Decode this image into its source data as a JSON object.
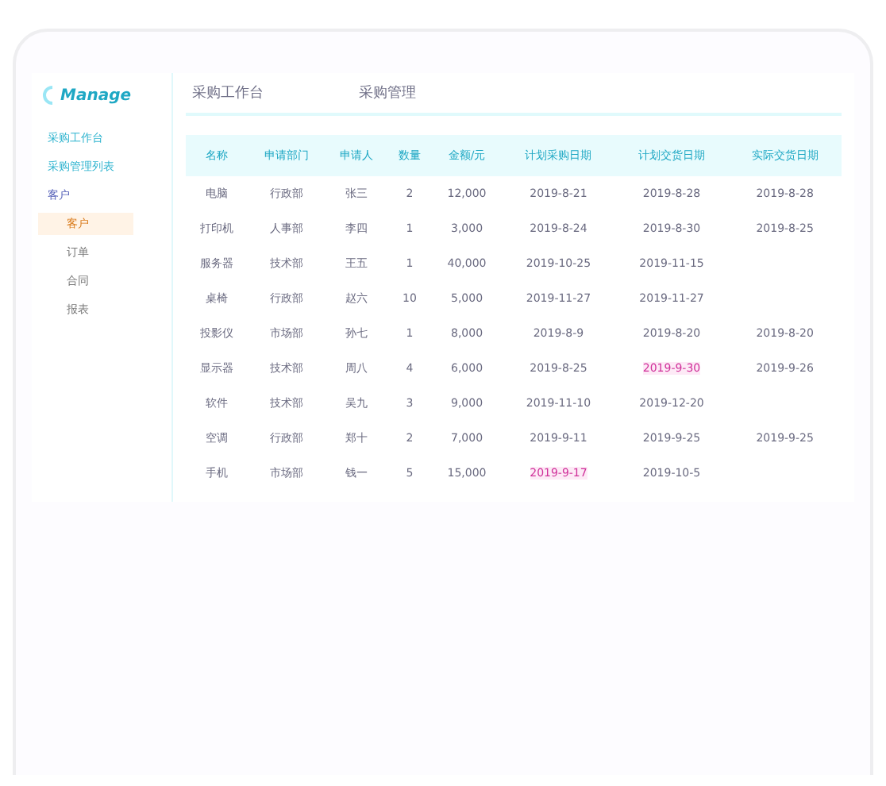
{
  "brand": "Manage",
  "breadcrumb": [
    "采购工作台",
    "采购管理"
  ],
  "sidebar": {
    "items": [
      {
        "label": "采购工作台",
        "selected": false
      },
      {
        "label": "采购管理列表",
        "selected": false
      },
      {
        "label": "客户",
        "selected": true,
        "children": [
          {
            "label": "客户",
            "selected": true
          },
          {
            "label": "订单",
            "selected": false
          },
          {
            "label": "合同",
            "selected": false
          },
          {
            "label": "报表",
            "selected": false
          }
        ]
      }
    ]
  },
  "table": {
    "columns": [
      "名称",
      "申请部门",
      "申请人",
      "数量",
      "金额/元",
      "计划采购日期",
      "计划交货日期",
      "实际交货日期"
    ],
    "rows": [
      {
        "cells": [
          "电脑",
          "行政部",
          "张三",
          "2",
          "12,000",
          "2019-8-21",
          "2019-8-28",
          "2019-8-28"
        ],
        "purchase_overdue": false,
        "delivery_overdue": false
      },
      {
        "cells": [
          "打印机",
          "人事部",
          "李四",
          "1",
          "3,000",
          "2019-8-24",
          "2019-8-30",
          "2019-8-25"
        ],
        "purchase_overdue": false,
        "delivery_overdue": false
      },
      {
        "cells": [
          "服务器",
          "技术部",
          "王五",
          "1",
          "40,000",
          "2019-10-25",
          "2019-11-15",
          ""
        ],
        "purchase_overdue": false,
        "delivery_overdue": false
      },
      {
        "cells": [
          "桌椅",
          "行政部",
          "赵六",
          "10",
          "5,000",
          "2019-11-27",
          "2019-11-27",
          ""
        ],
        "purchase_overdue": false,
        "delivery_overdue": false
      },
      {
        "cells": [
          "投影仪",
          "市场部",
          "孙七",
          "1",
          "8,000",
          "2019-8-9",
          "2019-8-20",
          "2019-8-20"
        ],
        "purchase_overdue": false,
        "delivery_overdue": false
      },
      {
        "cells": [
          "显示器",
          "技术部",
          "周八",
          "4",
          "6,000",
          "2019-8-25",
          "2019-9-30",
          "2019-9-26"
        ],
        "purchase_overdue": false,
        "delivery_overdue": true
      },
      {
        "cells": [
          "软件",
          "技术部",
          "吴九",
          "3",
          "9,000",
          "2019-11-10",
          "2019-12-20",
          ""
        ],
        "purchase_overdue": false,
        "delivery_overdue": false
      },
      {
        "cells": [
          "空调",
          "行政部",
          "郑十",
          "2",
          "7,000",
          "2019-9-11",
          "2019-9-25",
          "2019-9-25"
        ],
        "purchase_overdue": false,
        "delivery_overdue": false
      },
      {
        "cells": [
          "手机",
          "市场部",
          "钱一",
          "5",
          "15,000",
          "2019-9-17",
          "2019-10-5",
          ""
        ],
        "purchase_overdue": true,
        "delivery_overdue": false
      }
    ]
  }
}
